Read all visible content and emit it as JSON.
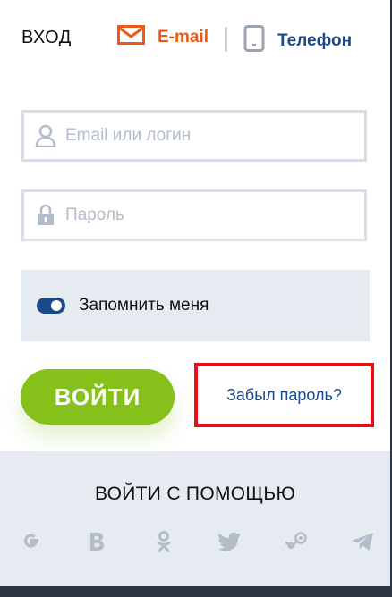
{
  "header": {
    "title": "ВХОД",
    "tabs": [
      {
        "label": "E-mail",
        "icon": "envelope-icon",
        "active": true
      },
      {
        "label": "Телефон",
        "icon": "phone-icon",
        "active": false
      }
    ]
  },
  "form": {
    "login": {
      "placeholder": "Email или логин",
      "value": "",
      "icon": "user-icon"
    },
    "password": {
      "placeholder": "Пароль",
      "value": "",
      "icon": "lock-icon"
    },
    "remember": {
      "label": "Запомнить меня",
      "checked": true
    },
    "submit_label": "ВОЙТИ",
    "forgot_label": "Забыл пароль?"
  },
  "social": {
    "title": "ВОЙТИ С ПОМОЩЬЮ",
    "providers": [
      "google-icon",
      "vk-icon",
      "odnoklassniki-icon",
      "twitter-icon",
      "steam-icon",
      "telegram-icon"
    ]
  },
  "colors": {
    "accent_orange": "#ee5a15",
    "brand_blue": "#1b4a8a",
    "button_green": "#86c11b",
    "highlight_red": "#e3101a",
    "panel_gray": "#e6ebf1"
  }
}
